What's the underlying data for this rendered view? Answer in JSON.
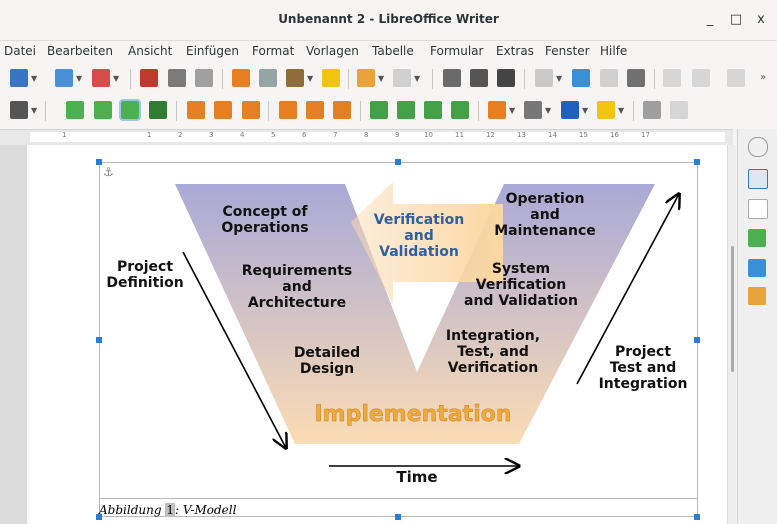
{
  "window": {
    "title": "Unbenannt 2 - LibreOffice Writer",
    "minimize": "_",
    "maximize": "□",
    "close": "x"
  },
  "menu": [
    "Datei",
    "Bearbeiten",
    "Ansicht",
    "Einfügen",
    "Format",
    "Vorlagen",
    "Tabelle",
    "Formular",
    "Extras",
    "Fenster",
    "Hilfe"
  ],
  "ruler": [
    "1",
    "1",
    "2",
    "3",
    "4",
    "5",
    "6",
    "7",
    "8",
    "9",
    "10",
    "11",
    "12",
    "13",
    "14",
    "15",
    "16",
    "17"
  ],
  "diagram": {
    "concept": [
      "Concept of",
      "Operations"
    ],
    "requirements": [
      "Requirements",
      "and",
      "Architecture"
    ],
    "detailed": [
      "Detailed",
      "Design"
    ],
    "implementation": "Implementation",
    "integration": [
      "Integration,",
      "Test, and",
      "Verification"
    ],
    "system": [
      "System",
      "Verification",
      "and Validation"
    ],
    "operation": [
      "Operation",
      "and",
      "Maintenance"
    ],
    "vv": [
      "Verification",
      "and",
      "Validation"
    ],
    "project_def": [
      "Project",
      "Definition"
    ],
    "project_test": [
      "Project",
      "Test and",
      "Integration"
    ],
    "time": "Time"
  },
  "caption": {
    "prefix": "Abbildung ",
    "number": "1",
    "suffix": ": V-Modell"
  },
  "colors": {
    "accent": "#2a7fd4",
    "v_top": "#a9a9d6",
    "v_bottom": "#fbdcb4",
    "implementation": "#f0a93b",
    "vv_text": "#2f5f9e"
  }
}
